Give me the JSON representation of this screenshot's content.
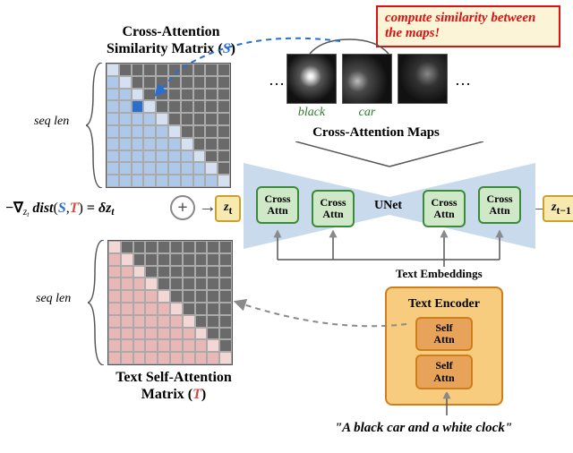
{
  "callout": "compute similarity between the maps!",
  "crossSim": {
    "title_line1": "Cross-Attention",
    "title_line2_prefix": "Similarity Matrix (",
    "title_line2_suffix": ")",
    "symbol": "S",
    "seq_label": "seq len",
    "grid": 10
  },
  "textSim": {
    "title_line1": "Text Self-Attention",
    "title_line2_prefix": "Matrix (",
    "title_line2_suffix": ")",
    "symbol": "T",
    "seq_label": "seq len",
    "grid": 10
  },
  "attn_maps": {
    "labels": [
      "black",
      "car",
      ""
    ],
    "title": "Cross-Attention Maps",
    "ellipsis": "…"
  },
  "unet": {
    "label": "UNet",
    "cross_label_line1": "Cross",
    "cross_label_line2": "Attn"
  },
  "latents": {
    "zt": "z",
    "zt_sub": "t",
    "zt1": "z",
    "zt1_sub": "t−1",
    "delta": "δz",
    "delta_sub": "t"
  },
  "formula": {
    "neg_grad": "−∇",
    "grad_sub": "z_t",
    "dist": "dist",
    "open": "(",
    "comma": ",",
    "close": ")",
    "equals": " = "
  },
  "encoder": {
    "title": "Text Encoder",
    "block_line1": "Self",
    "block_line2": "Attn",
    "te_label": "Text Embeddings"
  },
  "prompt": "\"A black car and a white clock\""
}
